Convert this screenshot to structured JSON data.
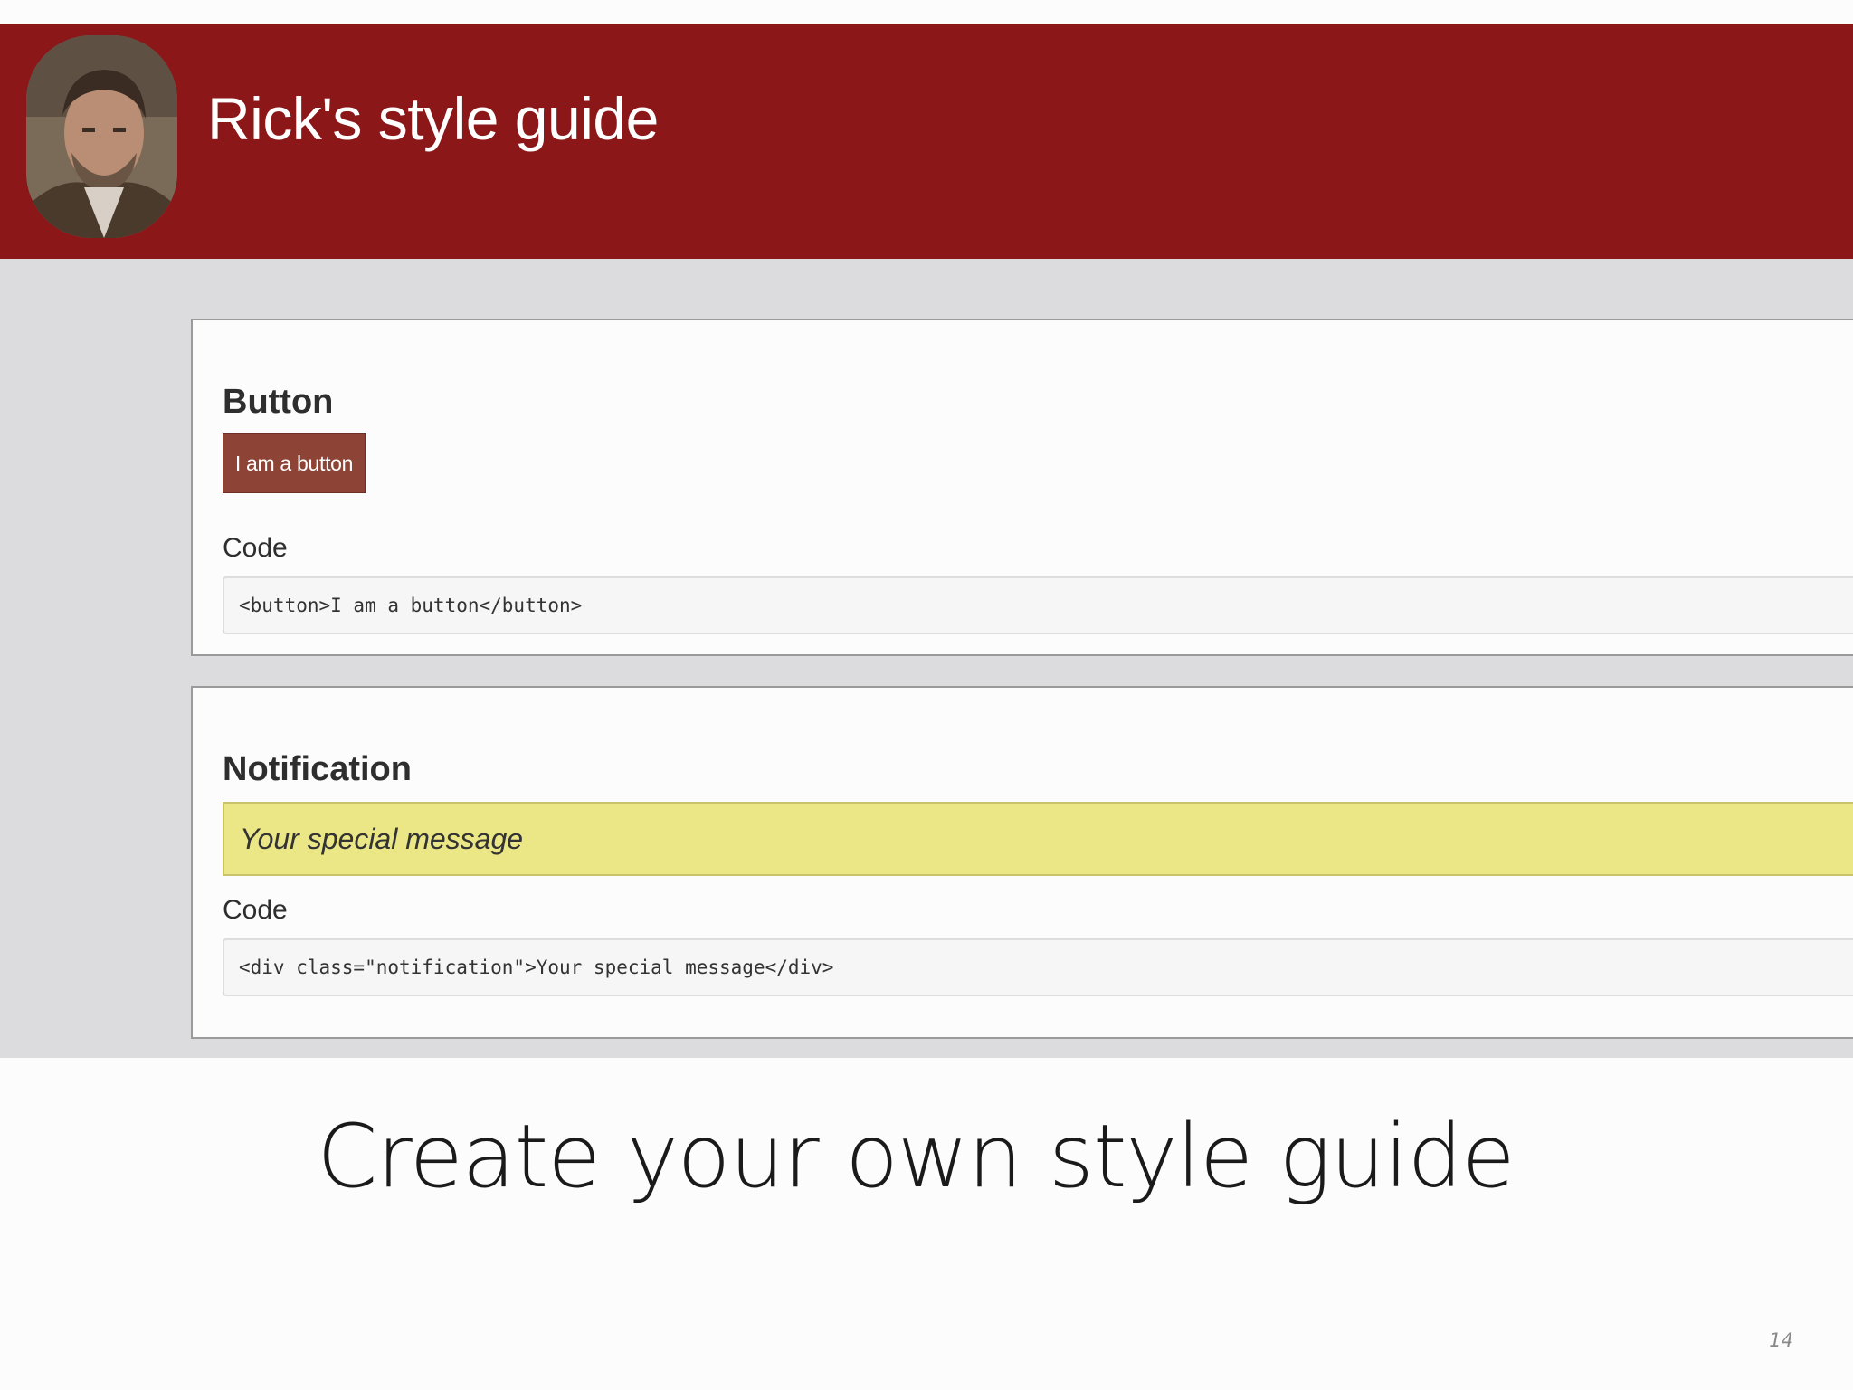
{
  "header": {
    "title": "Rick's style guide",
    "background_color": "#8b1718"
  },
  "sections": {
    "button": {
      "title": "Button",
      "demo_label": "I am a button",
      "code_label": "Code",
      "code": "<button>I am a button</button>",
      "button_color": "#8d4335"
    },
    "notification": {
      "title": "Notification",
      "message": "Your special message",
      "code_label": "Code",
      "code": "<div class=\"notification\">Your special message</div>",
      "notification_color": "#ece786"
    }
  },
  "slide": {
    "caption": "Create your own style guide",
    "page_number": "14"
  }
}
